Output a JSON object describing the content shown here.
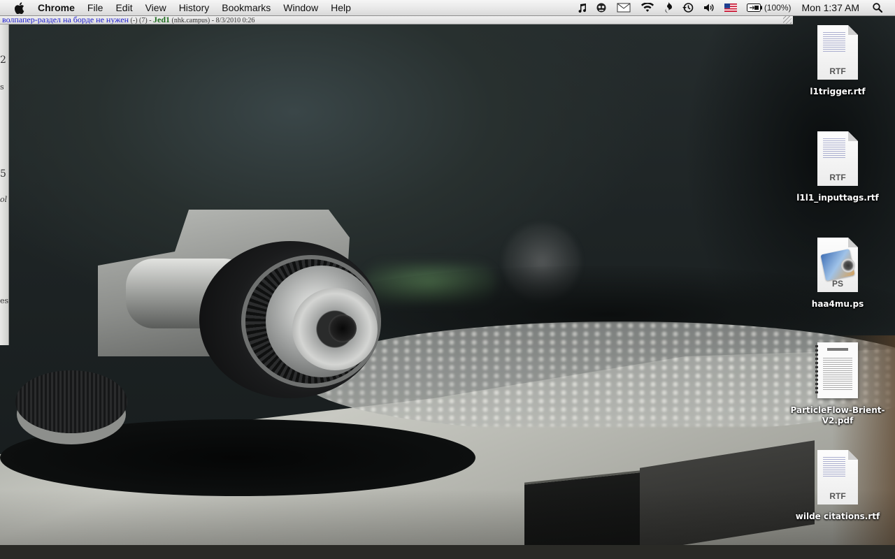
{
  "menubar": {
    "app_name": "Chrome",
    "menus": [
      "File",
      "Edit",
      "View",
      "History",
      "Bookmarks",
      "Window",
      "Help"
    ],
    "status_icons": [
      "itunes-note-icon",
      "skype-alien-icon",
      "mail-envelope-icon",
      "wifi-icon",
      "script-icon",
      "time-machine-icon",
      "volume-icon",
      "us-flag-icon",
      "battery-icon"
    ],
    "battery_percent": "(100%)",
    "clock": "Mon 1:37 AM"
  },
  "window_strip": {
    "link_text": "волпапер-раздел на борде не нужен",
    "meta_text": " (-) (7) - ",
    "author": "Jed1",
    "host": " (nhk.campus) - 8/3/2010 0:26"
  },
  "side_glyphs": [
    "2",
    "s",
    "5",
    "ol",
    "es"
  ],
  "desktop": {
    "icons": [
      {
        "label": "l1trigger.rtf",
        "type": "RTF"
      },
      {
        "label": "l1l1_inputtags.rtf",
        "type": "RTF"
      },
      {
        "label": "haa4mu.ps",
        "type": "PS"
      },
      {
        "label": "ParticleFlow-Brient-V2.pdf",
        "type": "PDF"
      },
      {
        "label": "wilde citations.rtf",
        "type": "RTF"
      }
    ]
  }
}
